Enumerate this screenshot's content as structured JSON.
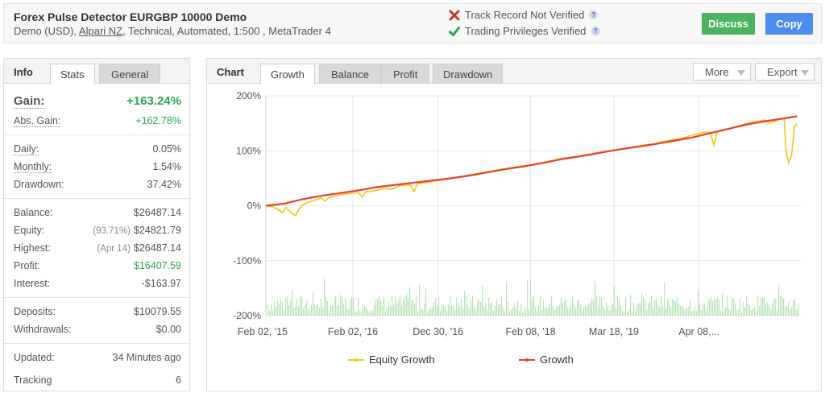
{
  "header": {
    "title": "Forex Pulse Detector EURGBP 10000 Demo",
    "sub_prefix": "Demo (USD),",
    "broker_link": "Alpari NZ",
    "sub_suffix": ", Technical, Automated, 1:500 , MetaTrader 4",
    "status_track": "Track Record Not Verified",
    "status_trading": "Trading Privileges Verified",
    "help_glyph": "?",
    "discuss_label": "Discuss",
    "copy_label": "Copy",
    "colors": {
      "discuss": "#4cb35e",
      "copy": "#4b8ef0",
      "not_verified": "#c0392b",
      "verified": "#2ea44f"
    }
  },
  "left_panel": {
    "tab_head": "Info",
    "tabs": [
      "Stats",
      "General"
    ],
    "active_tab": "Stats",
    "gain": {
      "label": "Gain:",
      "value": "+163.24%"
    },
    "abs_gain": {
      "label": "Abs. Gain:",
      "value": "+162.78%"
    },
    "daily": {
      "label": "Daily:",
      "value": "0.05%"
    },
    "monthly": {
      "label": "Monthly:",
      "value": "1.54%"
    },
    "drawdown": {
      "label": "Drawdown:",
      "value": "37.42%"
    },
    "balance": {
      "label": "Balance:",
      "value": "$26487.14"
    },
    "equity": {
      "label": "Equity:",
      "pre": "(93.71%)",
      "value": "$24821.79"
    },
    "highest": {
      "label": "Highest:",
      "pre": "(Apr 14)",
      "value": "$26487.14"
    },
    "profit": {
      "label": "Profit:",
      "value": "$16407.59"
    },
    "interest": {
      "label": "Interest:",
      "value": "-$163.97"
    },
    "deposits": {
      "label": "Deposits:",
      "value": "$10079.55"
    },
    "withdrawals": {
      "label": "Withdrawals:",
      "value": "$0.00"
    },
    "updated": {
      "label": "Updated:",
      "value": "34 Minutes ago"
    },
    "tracking": {
      "label": "Tracking",
      "value": "6"
    }
  },
  "chart_panel": {
    "tab_head": "Chart",
    "tabs": [
      "Growth",
      "Balance",
      "Profit",
      "Drawdown"
    ],
    "active_tab": "Growth",
    "more_label": "More",
    "export_label": "Export"
  },
  "chart_data": {
    "type": "line",
    "title": "",
    "ylim": [
      -200,
      200
    ],
    "y_ticks": [
      "200%",
      "100%",
      "0%",
      "-100%",
      "-200%"
    ],
    "y_tick_values": [
      200,
      100,
      0,
      -100,
      -200
    ],
    "x_ticks": [
      "Feb 02, '15",
      "Feb 02, '16",
      "Dec 30, '16",
      "Feb 08, '18",
      "Mar 18, '19",
      "Apr 08,..."
    ],
    "grid": true,
    "legend_position": "bottom",
    "series": [
      {
        "name": "Equity Growth",
        "color": "#f5c518",
        "points": [
          [
            0,
            0
          ],
          [
            0.2,
            -2
          ],
          [
            0.35,
            -8
          ],
          [
            0.45,
            -12
          ],
          [
            0.55,
            -3
          ],
          [
            0.7,
            -14
          ],
          [
            0.8,
            -18
          ],
          [
            0.9,
            -5
          ],
          [
            1.0,
            2
          ],
          [
            1.3,
            10
          ],
          [
            1.5,
            14
          ],
          [
            1.6,
            8
          ],
          [
            1.7,
            15
          ],
          [
            2.0,
            20
          ],
          [
            2.5,
            24
          ],
          [
            2.6,
            16
          ],
          [
            2.7,
            25
          ],
          [
            3.0,
            28
          ],
          [
            3.2,
            32
          ],
          [
            3.4,
            30
          ],
          [
            3.6,
            36
          ],
          [
            3.9,
            38
          ],
          [
            4.0,
            26
          ],
          [
            4.1,
            40
          ],
          [
            4.5,
            44
          ],
          [
            5.0,
            50
          ],
          [
            5.5,
            56
          ],
          [
            6.0,
            62
          ],
          [
            6.5,
            68
          ],
          [
            7.0,
            73
          ],
          [
            7.5,
            79
          ],
          [
            8.0,
            86
          ],
          [
            8.5,
            91
          ],
          [
            9.0,
            97
          ],
          [
            9.5,
            102
          ],
          [
            10.0,
            108
          ],
          [
            10.5,
            113
          ],
          [
            10.8,
            118
          ],
          [
            11.2,
            122
          ],
          [
            11.5,
            128
          ],
          [
            11.8,
            133
          ],
          [
            12.0,
            134
          ],
          [
            12.1,
            110
          ],
          [
            12.2,
            136
          ],
          [
            12.6,
            142
          ],
          [
            12.9,
            148
          ],
          [
            13.2,
            153
          ],
          [
            13.5,
            156
          ],
          [
            13.6,
            150
          ],
          [
            13.9,
            158
          ],
          [
            14.0,
            159
          ],
          [
            14.05,
            100
          ],
          [
            14.12,
            78
          ],
          [
            14.2,
            92
          ],
          [
            14.28,
            145
          ],
          [
            14.35,
            150
          ]
        ]
      },
      {
        "name": "Growth",
        "color": "#e8412c",
        "points": [
          [
            0,
            0
          ],
          [
            0.5,
            4
          ],
          [
            1.0,
            12
          ],
          [
            1.5,
            18
          ],
          [
            2.0,
            23
          ],
          [
            2.5,
            28
          ],
          [
            3.0,
            34
          ],
          [
            3.5,
            38
          ],
          [
            4.0,
            42
          ],
          [
            4.5,
            46
          ],
          [
            5.0,
            50
          ],
          [
            5.5,
            55
          ],
          [
            6.0,
            61
          ],
          [
            6.5,
            67
          ],
          [
            7.0,
            72
          ],
          [
            7.5,
            78
          ],
          [
            8.0,
            85
          ],
          [
            8.5,
            90
          ],
          [
            9.0,
            96
          ],
          [
            9.5,
            102
          ],
          [
            10.0,
            107
          ],
          [
            10.5,
            112
          ],
          [
            11.0,
            118
          ],
          [
            11.5,
            124
          ],
          [
            12.0,
            132
          ],
          [
            12.5,
            140
          ],
          [
            13.0,
            148
          ],
          [
            13.5,
            154
          ],
          [
            14.0,
            159
          ],
          [
            14.35,
            163
          ]
        ]
      }
    ],
    "volume_bars": "present"
  }
}
